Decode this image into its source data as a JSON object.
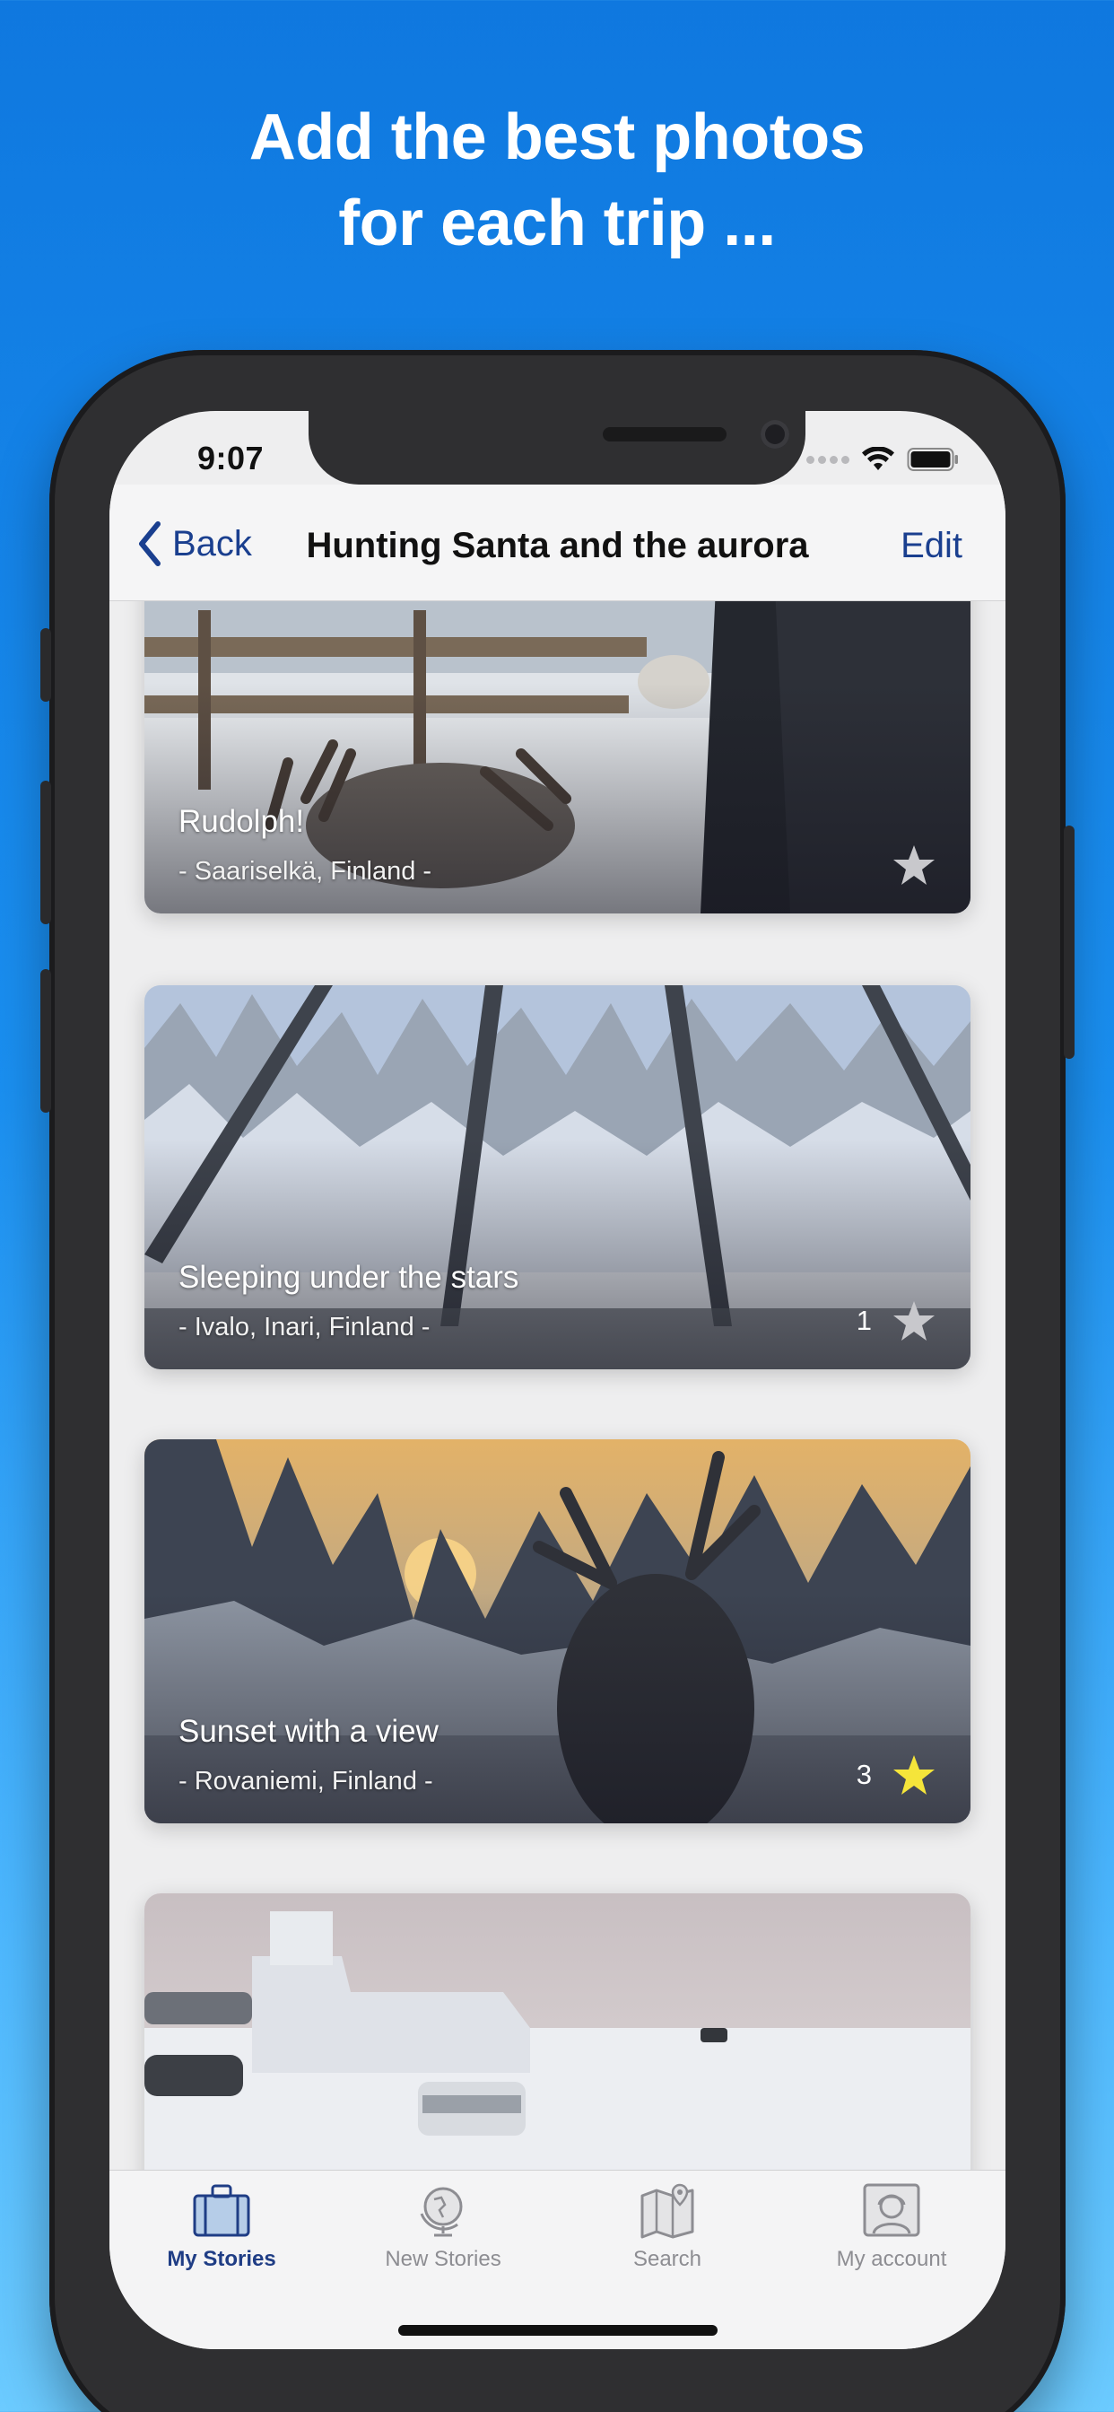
{
  "headline": {
    "line1": "Add the best photos",
    "line2": "for each trip ..."
  },
  "status": {
    "time": "9:07"
  },
  "nav": {
    "back_label": "Back",
    "title": "Hunting Santa and the aurora",
    "edit_label": "Edit"
  },
  "cards": [
    {
      "title": "Rudolph!",
      "place": "- Saariselkä, Finland -",
      "count": "",
      "starred": false
    },
    {
      "title": "Sleeping under the stars",
      "place": "- Ivalo, Inari, Finland -",
      "count": "1",
      "starred": false
    },
    {
      "title": "Sunset with a view",
      "place": "- Rovaniemi, Finland -",
      "count": "3",
      "starred": true
    },
    {
      "title": "",
      "place": "",
      "count": "",
      "starred": false
    }
  ],
  "tabs": [
    {
      "label": "My Stories",
      "icon": "suitcase-icon",
      "active": true
    },
    {
      "label": "New Stories",
      "icon": "globe-icon",
      "active": false
    },
    {
      "label": "Search",
      "icon": "map-icon",
      "active": false
    },
    {
      "label": "My account",
      "icon": "avatar-icon",
      "active": false
    }
  ],
  "colors": {
    "accent": "#1a3f8f",
    "star_active": "#f5e53a",
    "star_inactive": "#c8c8cc",
    "background_top": "#0f78df",
    "background_bottom": "#6ccbff"
  }
}
